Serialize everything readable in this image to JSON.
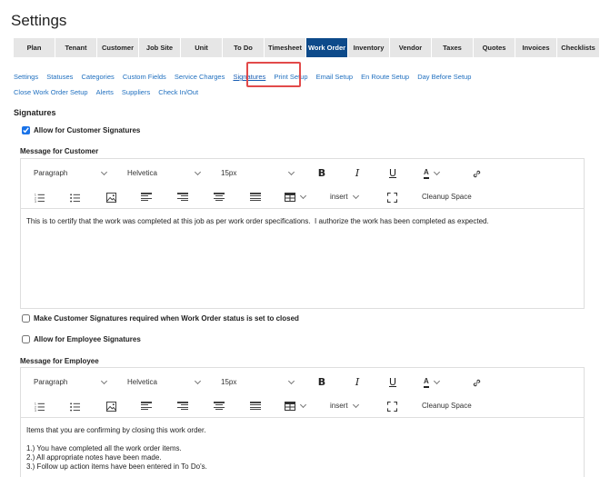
{
  "page_title": "Settings",
  "main_tabs": [
    {
      "label": "Plan",
      "active": false
    },
    {
      "label": "Tenant",
      "active": false
    },
    {
      "label": "Customer",
      "active": false
    },
    {
      "label": "Job Site",
      "active": false
    },
    {
      "label": "Unit",
      "active": false
    },
    {
      "label": "To Do",
      "active": false
    },
    {
      "label": "Timesheet",
      "active": false
    },
    {
      "label": "Work Order",
      "active": true
    },
    {
      "label": "Inventory",
      "active": false
    },
    {
      "label": "Vendor",
      "active": false
    },
    {
      "label": "Taxes",
      "active": false
    },
    {
      "label": "Quotes",
      "active": false
    },
    {
      "label": "Invoices",
      "active": false
    },
    {
      "label": "Checklists",
      "active": false
    }
  ],
  "sub_tabs": [
    {
      "label": "Settings",
      "active": false
    },
    {
      "label": "Statuses",
      "active": false
    },
    {
      "label": "Categories",
      "active": false
    },
    {
      "label": "Custom Fields",
      "active": false
    },
    {
      "label": "Service Charges",
      "active": false
    },
    {
      "label": "Signatures",
      "active": true
    },
    {
      "label": "Print Setup",
      "active": false
    },
    {
      "label": "Email Setup",
      "active": false
    },
    {
      "label": "En Route Setup",
      "active": false
    },
    {
      "label": "Day Before Setup",
      "active": false
    },
    {
      "label": "Close Work Order Setup",
      "active": false
    },
    {
      "label": "Alerts",
      "active": false
    },
    {
      "label": "Suppliers",
      "active": false
    },
    {
      "label": "Check In/Out",
      "active": false
    }
  ],
  "section_title": "Signatures",
  "allow_customer": {
    "label": "Allow for Customer Signatures",
    "checked": true
  },
  "customer_message_label": "Message for Customer",
  "editor_toolbar": {
    "block_format": "Paragraph",
    "font_family": "Helvetica",
    "font_size": "15px",
    "bold": "B",
    "italic": "I",
    "underline": "U",
    "text_color": "A",
    "insert": "insert",
    "cleanup": "Cleanup Space"
  },
  "customer_message": "This is to certify that the work was completed at this job as per work order specifications.  I authorize the work has been completed as expected.",
  "require_closed": {
    "label": "Make Customer Signatures required when Work Order status is set to closed",
    "checked": false
  },
  "allow_employee": {
    "label": "Allow for Employee Signatures",
    "checked": false
  },
  "employee_message_label": "Message for Employee",
  "employee_message": "Items that you are confirming by closing this work order.\n\n1.) You have completed all the work order items.\n2.) All appropriate notes have been made.\n3.) Follow up action items have been entered in To Do's."
}
